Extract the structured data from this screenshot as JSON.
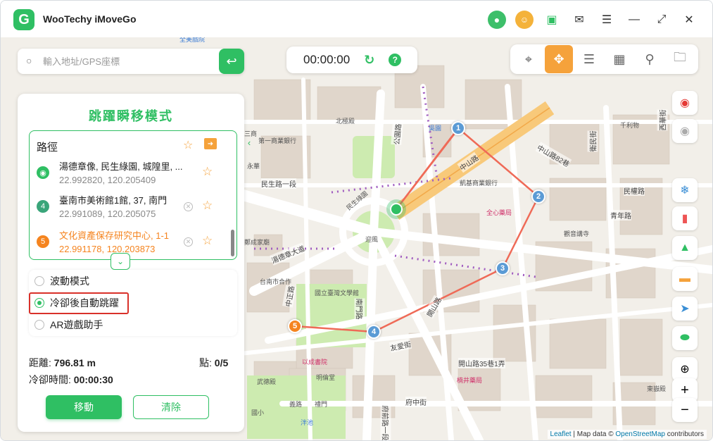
{
  "app": {
    "title": "WooTechy iMoveGo",
    "logo_letter": "G"
  },
  "titlebar_icons": [
    "avatar-icon",
    "gift-coin-icon",
    "toolbox-icon",
    "feedback-icon",
    "menu-icon",
    "minimize-icon",
    "restore-icon",
    "close-icon"
  ],
  "search": {
    "placeholder": "輸入地址/GPS座標",
    "value": ""
  },
  "timer": {
    "time": "00:00:00"
  },
  "mode_toolbar": [
    {
      "name": "teleport-mode",
      "icon": "crosshair-icon",
      "active": false
    },
    {
      "name": "jump-teleport-mode",
      "icon": "move-arrows-icon",
      "active": true
    },
    {
      "name": "two-spot-mode",
      "icon": "lanes-icon",
      "active": false
    },
    {
      "name": "multi-spot-mode",
      "icon": "route-grid-icon",
      "active": false
    },
    {
      "name": "joystick-mode",
      "icon": "joystick-icon",
      "active": false
    },
    {
      "name": "history-mode",
      "icon": "folder-history-icon",
      "active": false
    }
  ],
  "panel": {
    "title": "跳躍瞬移模式",
    "route_label": "路徑",
    "route_items": [
      {
        "num": "",
        "name": "湯德章像, 民生綠園, 城隍里, ...",
        "coord": "22.992820, 120.205409",
        "color": "#2fbf63",
        "highlight": false
      },
      {
        "num": "4",
        "name": "臺南市美術館1館, 37, 南門",
        "coord": "22.991089, 120.205075",
        "color": "#3aa57a",
        "highlight": false
      },
      {
        "num": "5",
        "name": "文化資產保存研究中心, 1-1",
        "coord": "22.991178, 120.203873",
        "color": "#f5841f",
        "highlight": true
      }
    ],
    "options": [
      {
        "label": "波動模式",
        "selected": false
      },
      {
        "label": "冷卻後自動跳躍",
        "selected": true
      },
      {
        "label": "AR遊戲助手",
        "selected": false
      }
    ],
    "distance_label": "距離:",
    "distance_value": "796.81 m",
    "points_label": "點:",
    "points_value": "0/5",
    "cooldown_label": "冷卻時間:",
    "cooldown_value": "00:00:30",
    "move_button": "移動",
    "clear_button": "清除"
  },
  "map_labels": {
    "streets": [
      "民生路一段",
      "中山路",
      "公園路",
      "湯德章大道",
      "南門路",
      "友愛街",
      "開山路",
      "中正路",
      "府前路一段",
      "青年路",
      "民權路",
      "府中街",
      "衛民街",
      "西華街",
      "中山路82巷",
      "開山路35巷1弄"
    ],
    "places": [
      "北極殿",
      "第一商業銀行",
      "國立臺灣文學館",
      "台南市合作",
      "鄭成家廟",
      "以成書院",
      "明倫堂",
      "武德殿",
      "吳園",
      "凱基商業銀行",
      "全心藥局",
      "觀音講寺",
      "千利物",
      "東嶽殿",
      "楠井藥局",
      "禮門",
      "義路",
      "迎風",
      "民生綠園",
      "國小",
      "泮池",
      "三商",
      "永華",
      "全美戲院"
    ]
  },
  "attribution": {
    "leaflet": "Leaflet",
    "sep": "| Map data ©",
    "osm": "OpenStreetMap",
    "suffix": "contributors"
  },
  "waypoints": [
    "1",
    "2",
    "3",
    "4",
    "5"
  ],
  "colors": {
    "brand_green": "#2fbf63",
    "accent_orange": "#f5a23b",
    "route_red": "#ef6a57",
    "waypoint_blue": "#5b9bd5"
  }
}
